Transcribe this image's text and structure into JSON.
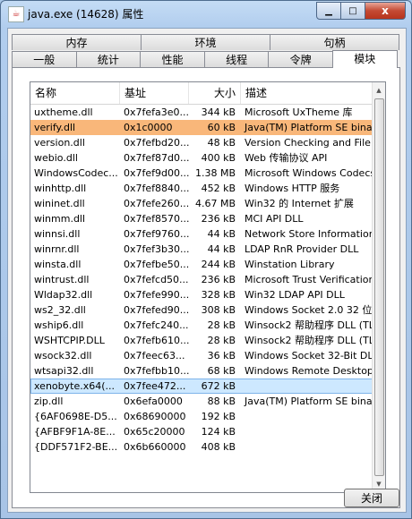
{
  "window": {
    "title": "java.exe (14628) 属性",
    "controls": {
      "minimize": "▁",
      "maximize": "□",
      "close": "x"
    }
  },
  "tabs": {
    "back_row": [
      "内存",
      "环境",
      "句柄"
    ],
    "front_row": [
      "一般",
      "统计",
      "性能",
      "线程",
      "令牌",
      "模块"
    ],
    "active": "模块"
  },
  "modules": {
    "columns": {
      "name": "名称",
      "base": "基址",
      "size": "大小",
      "desc": "描述"
    },
    "rows": [
      {
        "name": "uxtheme.dll",
        "base": "0x7fefa3e0...",
        "size": "344 kB",
        "desc": "Microsoft UxTheme 库"
      },
      {
        "name": "verify.dll",
        "base": "0x1c0000",
        "size": "60 kB",
        "desc": "Java(TM) Platform SE binary",
        "highlight": "orange"
      },
      {
        "name": "version.dll",
        "base": "0x7fefbd20...",
        "size": "48 kB",
        "desc": "Version Checking and File In"
      },
      {
        "name": "webio.dll",
        "base": "0x7fef87d0...",
        "size": "400 kB",
        "desc": "Web 传输协议 API"
      },
      {
        "name": "WindowsCodec...",
        "base": "0x7fef9d00...",
        "size": "1.38 MB",
        "desc": "Microsoft Windows Codecs L"
      },
      {
        "name": "winhttp.dll",
        "base": "0x7fef8840...",
        "size": "452 kB",
        "desc": "Windows HTTP 服务"
      },
      {
        "name": "wininet.dll",
        "base": "0x7fefe260...",
        "size": "4.67 MB",
        "desc": "Win32 的 Internet 扩展"
      },
      {
        "name": "winmm.dll",
        "base": "0x7fef8570...",
        "size": "236 kB",
        "desc": "MCI API DLL"
      },
      {
        "name": "winnsi.dll",
        "base": "0x7fef9760...",
        "size": "44 kB",
        "desc": "Network Store Information ."
      },
      {
        "name": "winrnr.dll",
        "base": "0x7fef3b30...",
        "size": "44 kB",
        "desc": "LDAP RnR Provider DLL"
      },
      {
        "name": "winsta.dll",
        "base": "0x7fefbe50...",
        "size": "244 kB",
        "desc": "Winstation Library"
      },
      {
        "name": "wintrust.dll",
        "base": "0x7fefcd50...",
        "size": "236 kB",
        "desc": "Microsoft Trust Verification ."
      },
      {
        "name": "Wldap32.dll",
        "base": "0x7fefe990...",
        "size": "328 kB",
        "desc": "Win32 LDAP API DLL"
      },
      {
        "name": "ws2_32.dll",
        "base": "0x7fefed90...",
        "size": "308 kB",
        "desc": "Windows Socket 2.0 32 位 D"
      },
      {
        "name": "wship6.dll",
        "base": "0x7fefc240...",
        "size": "28 kB",
        "desc": "Winsock2 帮助程序 DLL (TL"
      },
      {
        "name": "WSHTCPIP.DLL",
        "base": "0x7fefb610...",
        "size": "28 kB",
        "desc": "Winsock2 帮助程序 DLL (TL"
      },
      {
        "name": "wsock32.dll",
        "base": "0x7feec63...",
        "size": "36 kB",
        "desc": "Windows Socket 32-Bit DLL"
      },
      {
        "name": "wtsapi32.dll",
        "base": "0x7fefbb10...",
        "size": "68 kB",
        "desc": "Windows Remote Desktop S"
      },
      {
        "name": "xenobyte.x64(...",
        "base": "0x7fee472...",
        "size": "672 kB",
        "desc": "",
        "highlight": "blue"
      },
      {
        "name": "zip.dll",
        "base": "0x6efa0000",
        "size": "88 kB",
        "desc": "Java(TM) Platform SE binary"
      },
      {
        "name": "{6AF0698E-D5...",
        "base": "0x68690000",
        "size": "192 kB",
        "desc": ""
      },
      {
        "name": "{AFBF9F1A-8E...",
        "base": "0x65c20000",
        "size": "124 kB",
        "desc": ""
      },
      {
        "name": "{DDF571F2-BE...",
        "base": "0x6b660000",
        "size": "408 kB",
        "desc": ""
      }
    ]
  },
  "buttons": {
    "close": "关闭"
  }
}
